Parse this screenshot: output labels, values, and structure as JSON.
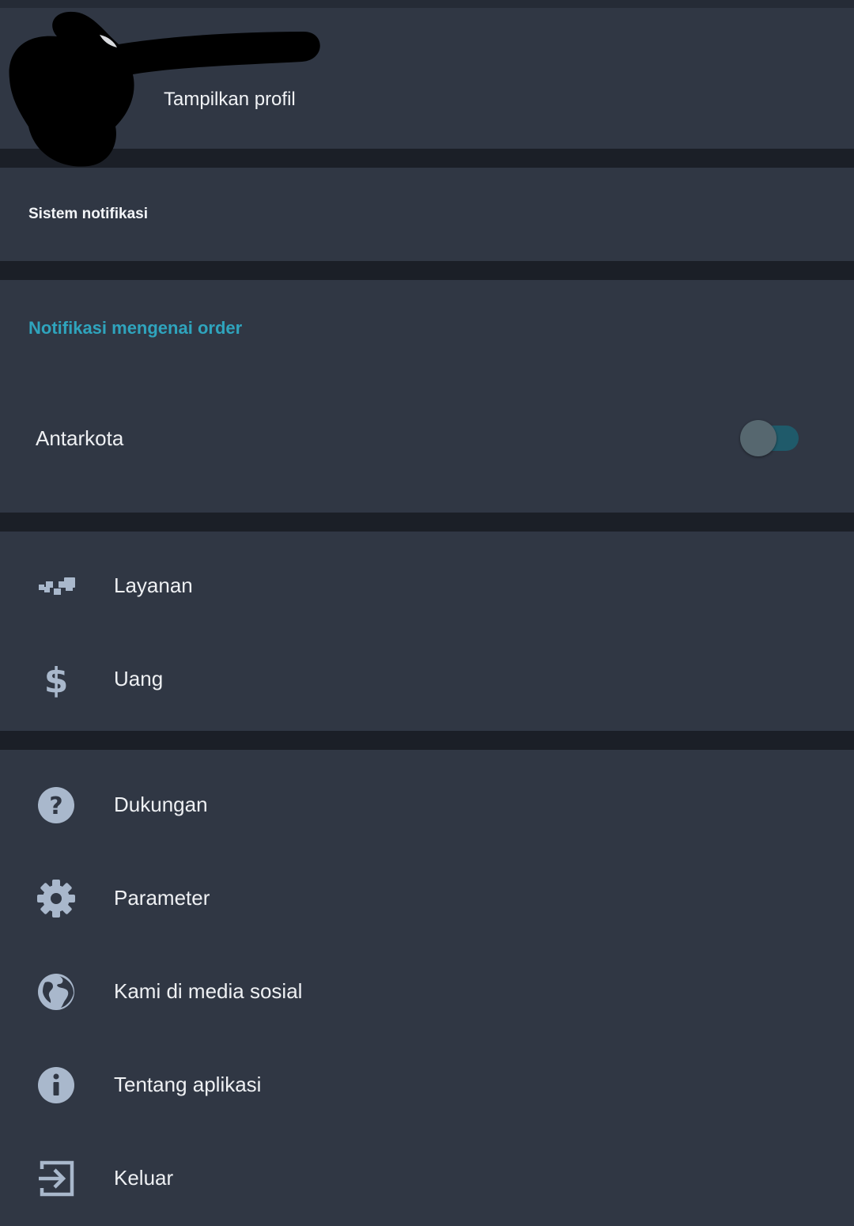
{
  "profile": {
    "view_profile_label": "Tampilkan profil"
  },
  "notification_system": {
    "title": "Sistem notifikasi"
  },
  "order_notifications": {
    "title": "Notifikasi mengenai order",
    "intercity": {
      "label": "Antarkota",
      "enabled": false
    }
  },
  "menu_primary": {
    "items": [
      {
        "label": "Layanan",
        "icon": "taxi-checker-icon"
      },
      {
        "label": "Uang",
        "icon": "dollar-icon"
      }
    ]
  },
  "menu_secondary": {
    "items": [
      {
        "label": "Dukungan",
        "icon": "help-circle-icon"
      },
      {
        "label": "Parameter",
        "icon": "gear-icon"
      },
      {
        "label": "Kami di media sosial",
        "icon": "globe-icon"
      },
      {
        "label": "Tentang aplikasi",
        "icon": "info-icon"
      },
      {
        "label": "Keluar",
        "icon": "logout-icon"
      }
    ]
  },
  "colors": {
    "panel_bg": "#303744",
    "divider_bg": "#1b1f27",
    "accent": "#2fa4bd",
    "icon": "#a9b8cc",
    "text": "#eef0f3"
  }
}
